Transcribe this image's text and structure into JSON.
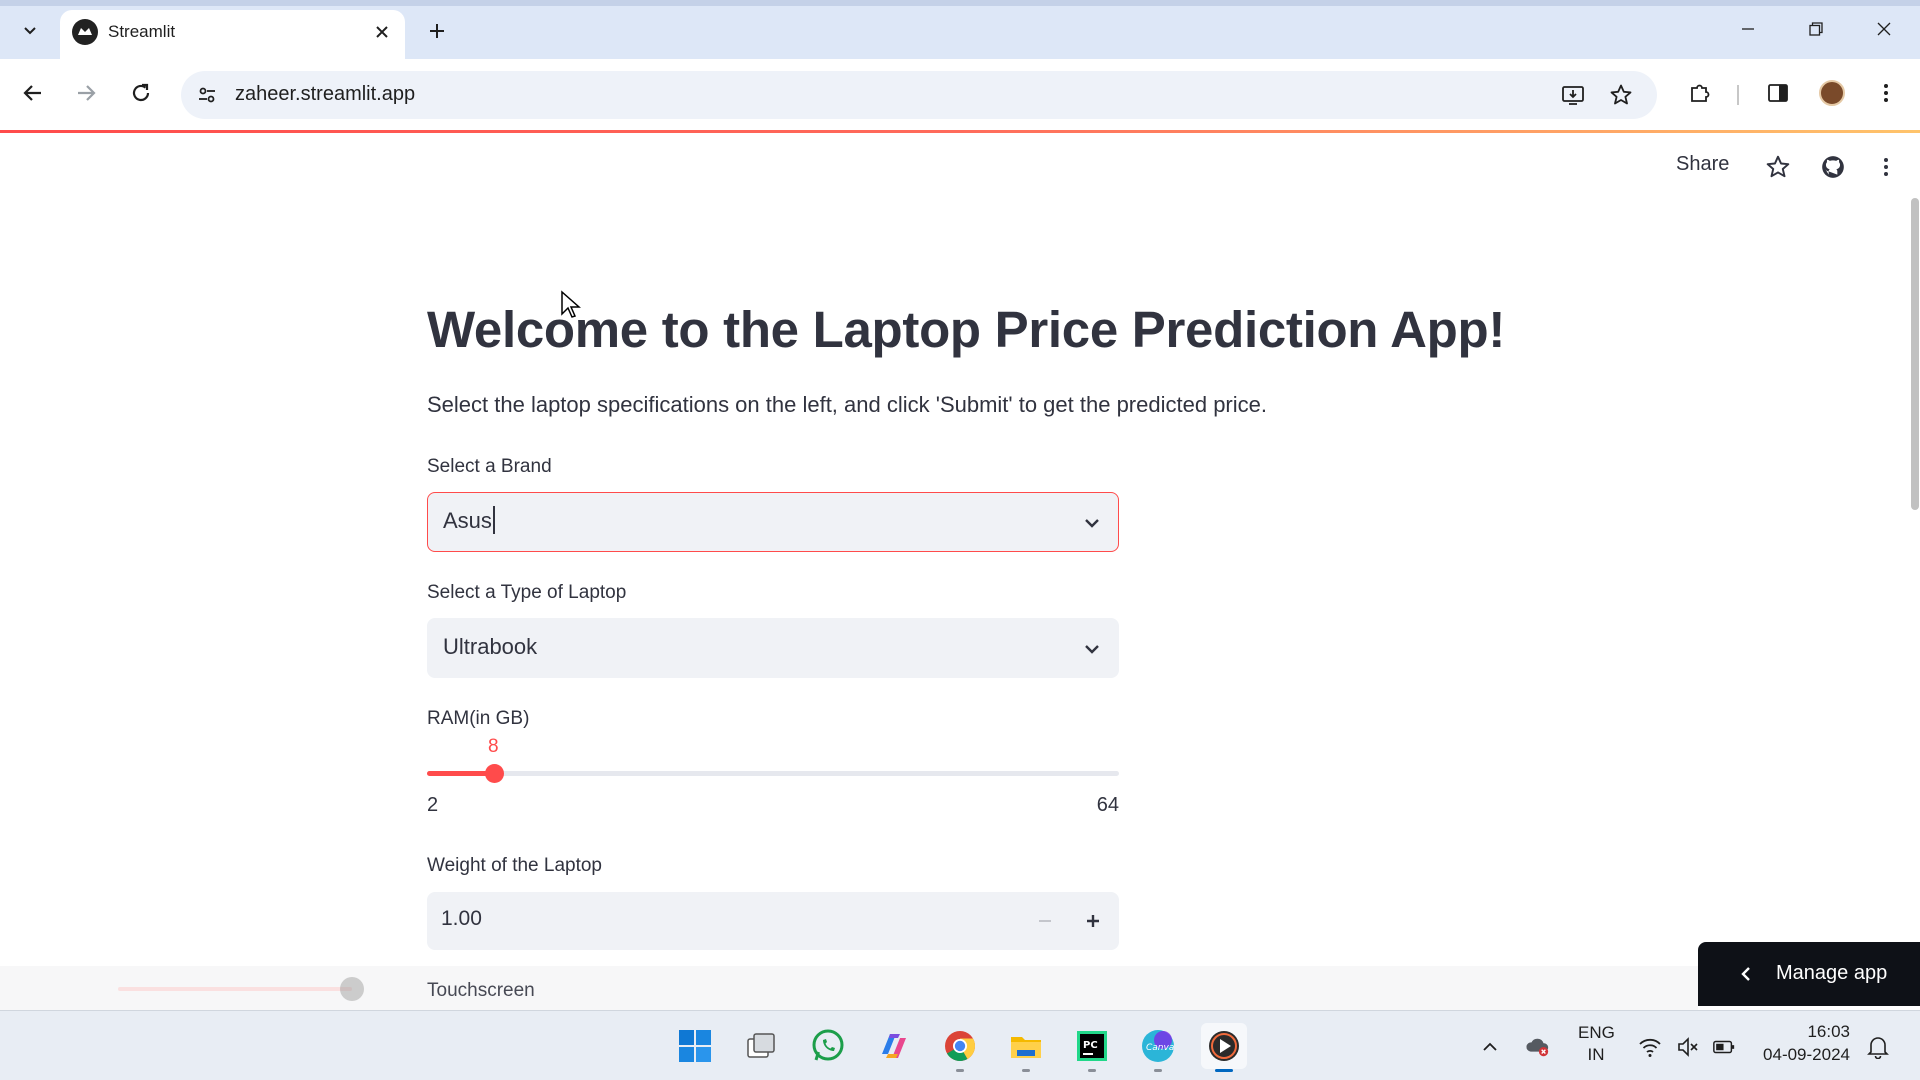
{
  "browser": {
    "tab_title": "Streamlit",
    "url": "zaheer.streamlit.app"
  },
  "streamlit_header": {
    "share_label": "Share"
  },
  "page": {
    "title": "Welcome to the Laptop Price Prediction App!",
    "intro": "Select the laptop specifications on the left, and click 'Submit' to get the predicted price.",
    "brand": {
      "label": "Select a Brand",
      "value": "Asus"
    },
    "type": {
      "label": "Select a Type of Laptop",
      "value": "Ultrabook"
    },
    "ram": {
      "label": "RAM(in GB)",
      "value": "8",
      "min": "2",
      "max": "64",
      "fraction": 0.0968
    },
    "weight": {
      "label": "Weight of the Laptop",
      "value": "1.00"
    },
    "touchscreen": {
      "label": "Touchscreen"
    }
  },
  "manage_app": {
    "label": "Manage app"
  },
  "taskbar": {
    "lang_line1": "ENG",
    "lang_line2": "IN",
    "time": "16:03",
    "date": "04-09-2024",
    "apps": [
      "start-icon",
      "task-view-icon",
      "whatsapp-icon",
      "copilot-icon",
      "chrome-icon",
      "file-explorer-icon",
      "pycharm-icon",
      "canva-icon",
      "media-player-icon"
    ]
  },
  "colors": {
    "accent": "#ff4b4b",
    "text": "#31333f",
    "input_bg": "#f0f2f6"
  }
}
